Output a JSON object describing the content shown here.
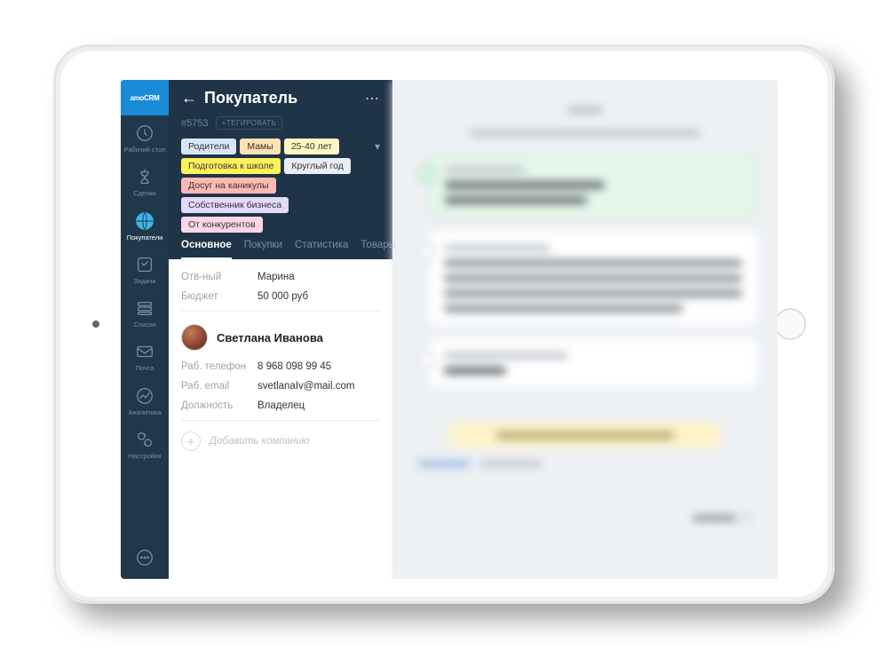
{
  "app": {
    "logo_text": "amoCRM"
  },
  "sidebar": {
    "items": [
      {
        "label": "Рабочий стол"
      },
      {
        "label": "Сделки"
      },
      {
        "label": "Покупатели"
      },
      {
        "label": "Задачи"
      },
      {
        "label": "Списки"
      },
      {
        "label": "Почта"
      },
      {
        "label": "Аналитика"
      },
      {
        "label": "Настройки"
      }
    ]
  },
  "panel": {
    "title": "Покупатель",
    "record_id": "#5753",
    "tag_button": "+ТЕГИРОВАТЬ",
    "tags": [
      {
        "text": "Родители",
        "color": "#d7e7fb"
      },
      {
        "text": "Мамы",
        "color": "#ffe1b3"
      },
      {
        "text": "25-40 лет",
        "color": "#fff7c2"
      },
      {
        "text": "Подготовка к школе",
        "color": "#fff15a"
      },
      {
        "text": "Круглый год",
        "color": "#e9eef4"
      },
      {
        "text": "Досуг на каникулы",
        "color": "#ffb9b3"
      },
      {
        "text": "Собственник бизнеса",
        "color": "#e3d9fb"
      },
      {
        "text": "От конкурентов",
        "color": "#ffd6e8"
      }
    ],
    "tabs": [
      {
        "label": "Основное",
        "active": true
      },
      {
        "label": "Покупки",
        "active": false
      },
      {
        "label": "Статистика",
        "active": false
      },
      {
        "label": "Товары",
        "active": false
      }
    ],
    "fields": {
      "responsible_label": "Отв-ный",
      "responsible_value": "Марина",
      "budget_label": "Бюджет",
      "budget_value": "50 000 руб"
    },
    "contact": {
      "name": "Светлана Иванова",
      "phone_label": "Раб. телефон",
      "phone_value": "8 968 098 99 45",
      "email_label": "Раб. email",
      "email_value": "svetlanaIv@mail.com",
      "position_label": "Должность",
      "position_value": "Владелец"
    },
    "add_company": "Добавить компанию"
  }
}
